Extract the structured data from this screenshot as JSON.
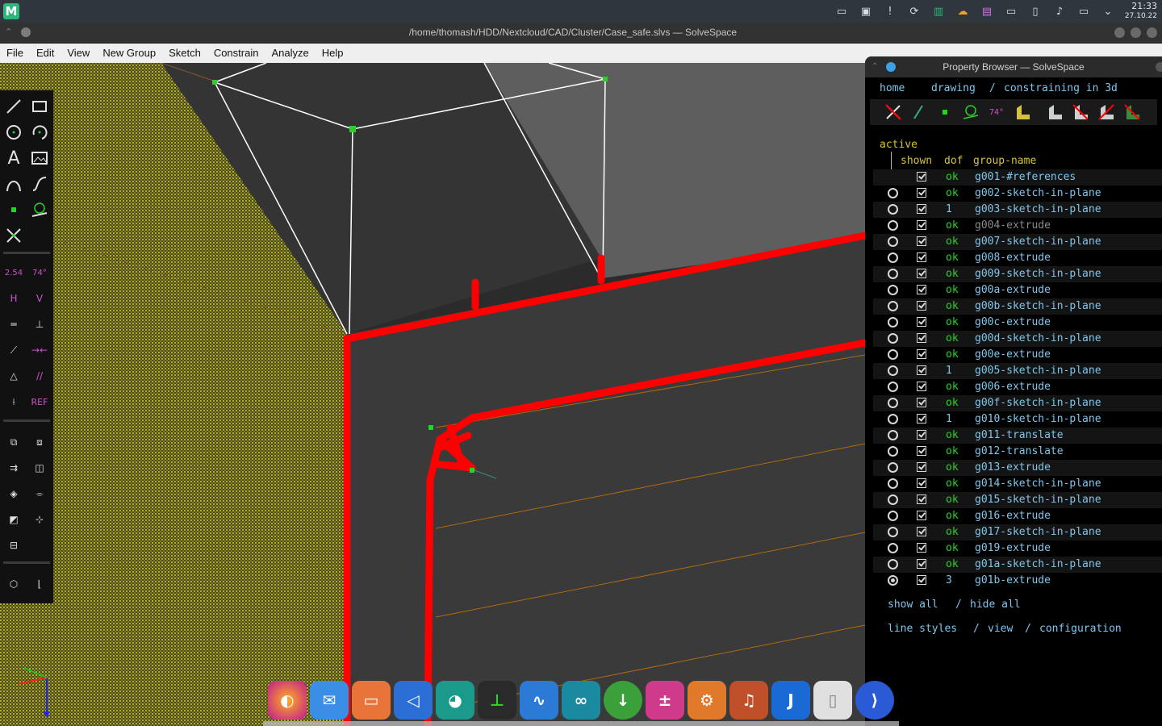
{
  "taskbar": {
    "logo": "M",
    "clock_time": "21:33",
    "clock_date": "27.10.22",
    "tray_icons": [
      "window-icon",
      "workspace-icon",
      "notification-icon",
      "update-icon",
      "manjaro-icon",
      "cloud-icon",
      "package-icon",
      "terminal-icon",
      "clipboard-icon",
      "volume-icon",
      "display-icon",
      "chevron-down-icon"
    ]
  },
  "window": {
    "title": "/home/thomash/HDD/Nextcloud/CAD/Cluster/Case_safe.slvs — SolveSpace"
  },
  "menu": {
    "items": [
      "File",
      "Edit",
      "View",
      "New Group",
      "Sketch",
      "Constrain",
      "Analyze",
      "Help"
    ]
  },
  "toolbar": {
    "labels": {
      "dim_distance": "2.54",
      "dim_angle": "74°",
      "horizontal": "H",
      "vertical": "V",
      "reference": "REF"
    }
  },
  "property_browser": {
    "title": "Property Browser — SolveSpace",
    "home": "home",
    "nav_drawing": "drawing",
    "nav_sep": "/",
    "nav_constraining": "constraining in 3d",
    "col_active": "active",
    "col_shown": "shown",
    "col_dof": "dof",
    "col_group": "group-name",
    "groups": [
      {
        "dof": "ok",
        "name": "g001-#references",
        "radio": false,
        "active": false,
        "dim": false
      },
      {
        "dof": "ok",
        "name": "g002-sketch-in-plane",
        "radio": true,
        "active": false,
        "dim": false
      },
      {
        "dof": "1",
        "name": "g003-sketch-in-plane",
        "radio": true,
        "active": false,
        "dim": false
      },
      {
        "dof": "ok",
        "name": "g004-extrude",
        "radio": true,
        "active": false,
        "dim": true
      },
      {
        "dof": "ok",
        "name": "g007-sketch-in-plane",
        "radio": true,
        "active": false,
        "dim": false
      },
      {
        "dof": "ok",
        "name": "g008-extrude",
        "radio": true,
        "active": false,
        "dim": false
      },
      {
        "dof": "ok",
        "name": "g009-sketch-in-plane",
        "radio": true,
        "active": false,
        "dim": false
      },
      {
        "dof": "ok",
        "name": "g00a-extrude",
        "radio": true,
        "active": false,
        "dim": false
      },
      {
        "dof": "ok",
        "name": "g00b-sketch-in-plane",
        "radio": true,
        "active": false,
        "dim": false
      },
      {
        "dof": "ok",
        "name": "g00c-extrude",
        "radio": true,
        "active": false,
        "dim": false
      },
      {
        "dof": "ok",
        "name": "g00d-sketch-in-plane",
        "radio": true,
        "active": false,
        "dim": false
      },
      {
        "dof": "ok",
        "name": "g00e-extrude",
        "radio": true,
        "active": false,
        "dim": false
      },
      {
        "dof": "1",
        "name": "g005-sketch-in-plane",
        "radio": true,
        "active": false,
        "dim": false
      },
      {
        "dof": "ok",
        "name": "g006-extrude",
        "radio": true,
        "active": false,
        "dim": false
      },
      {
        "dof": "ok",
        "name": "g00f-sketch-in-plane",
        "radio": true,
        "active": false,
        "dim": false
      },
      {
        "dof": "1",
        "name": "g010-sketch-in-plane",
        "radio": true,
        "active": false,
        "dim": false
      },
      {
        "dof": "ok",
        "name": "g011-translate",
        "radio": true,
        "active": false,
        "dim": false
      },
      {
        "dof": "ok",
        "name": "g012-translate",
        "radio": true,
        "active": false,
        "dim": false
      },
      {
        "dof": "ok",
        "name": "g013-extrude",
        "radio": true,
        "active": false,
        "dim": false
      },
      {
        "dof": "ok",
        "name": "g014-sketch-in-plane",
        "radio": true,
        "active": false,
        "dim": false
      },
      {
        "dof": "ok",
        "name": "g015-sketch-in-plane",
        "radio": true,
        "active": false,
        "dim": false
      },
      {
        "dof": "ok",
        "name": "g016-extrude",
        "radio": true,
        "active": false,
        "dim": false
      },
      {
        "dof": "ok",
        "name": "g017-sketch-in-plane",
        "radio": true,
        "active": false,
        "dim": false
      },
      {
        "dof": "ok",
        "name": "g019-extrude",
        "radio": true,
        "active": false,
        "dim": false
      },
      {
        "dof": "ok",
        "name": "g01a-sketch-in-plane",
        "radio": true,
        "active": false,
        "dim": false
      },
      {
        "dof": "3",
        "name": "g01b-extrude",
        "radio": true,
        "active": true,
        "dim": false
      }
    ],
    "show_all": "show all",
    "hide_all": "hide all",
    "line_styles": "line styles",
    "view": "view",
    "configuration": "configuration",
    "slash": "/"
  },
  "dock": {
    "apps": [
      "firefox-icon",
      "mail-icon",
      "files-icon",
      "telegram-icon",
      "mastodon-icon",
      "solvespace-icon",
      "waveform-icon",
      "arduino-icon",
      "download-icon",
      "calculator-icon",
      "settings-icon",
      "audio-icon",
      "joplin-icon",
      "document-icon",
      "vscode-icon"
    ]
  },
  "colors": {
    "accent_red": "#ff0000",
    "ok_green": "#26d426",
    "link_blue": "#7fc6ec",
    "hatch_yellow": "#d6d23a"
  }
}
